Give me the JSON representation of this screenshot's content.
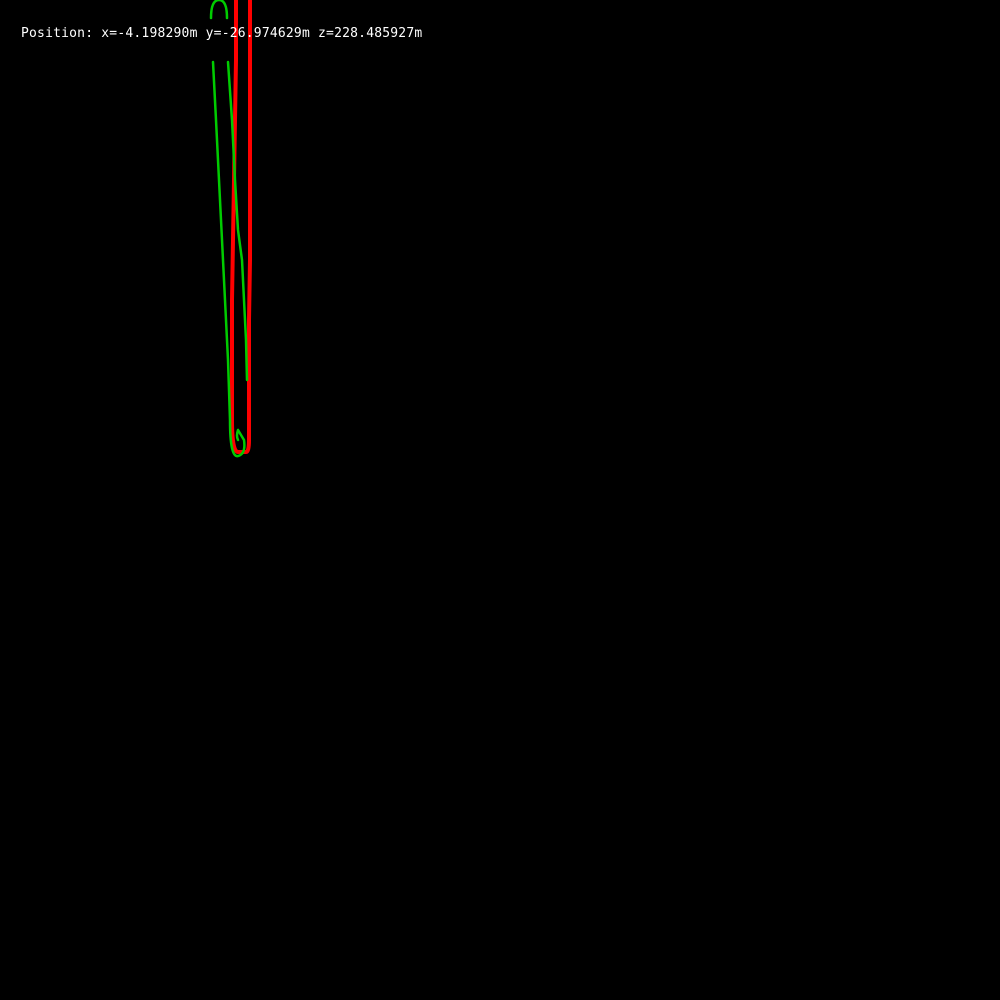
{
  "readout": {
    "label": "Position:",
    "x": "x=-4.198290m",
    "y": "y=-26.974629m",
    "z": "z=228.485927m"
  },
  "colors": {
    "background": "#000000",
    "text": "#ffffff",
    "ground_truth_path": "#ff0000",
    "estimated_path": "#00cc00"
  },
  "layers": {
    "ground_truth_path": "ground-truth-trajectory",
    "estimated_path": "estimated-trajectory"
  }
}
